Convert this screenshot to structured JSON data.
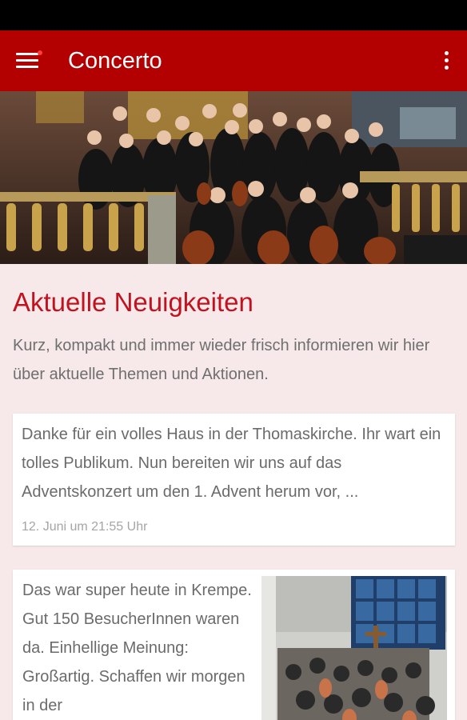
{
  "appbar": {
    "title": "Concerto",
    "menu_icon": "hamburger-menu-icon",
    "overflow_icon": "more-vertical-icon",
    "color": "#b30000"
  },
  "hero": {
    "image": "orchestra-group-photo"
  },
  "news": {
    "title": "Aktuelle Neuigkeiten",
    "subtitle": "Kurz, kompakt und immer wieder frisch informieren wir hier über aktuelle Themen und Aktionen.",
    "posts": [
      {
        "text": "Danke für ein volles Haus in der Thomaskirche. Ihr wart ein tolles Publikum. Nun bereiten wir uns auf das Adventskonzert um den 1. Advent herum vor, ...",
        "time": "12. Juni um 21:55 Uhr"
      },
      {
        "text": "Das war super heute in Krempe. Gut 150 BesucherInnen waren da. Einhellige Meinung: Großartig. Schaffen wir morgen in der",
        "image": "church-concert-photo"
      }
    ]
  },
  "colors": {
    "accent": "#c1121f",
    "background": "#f7e9ea"
  }
}
